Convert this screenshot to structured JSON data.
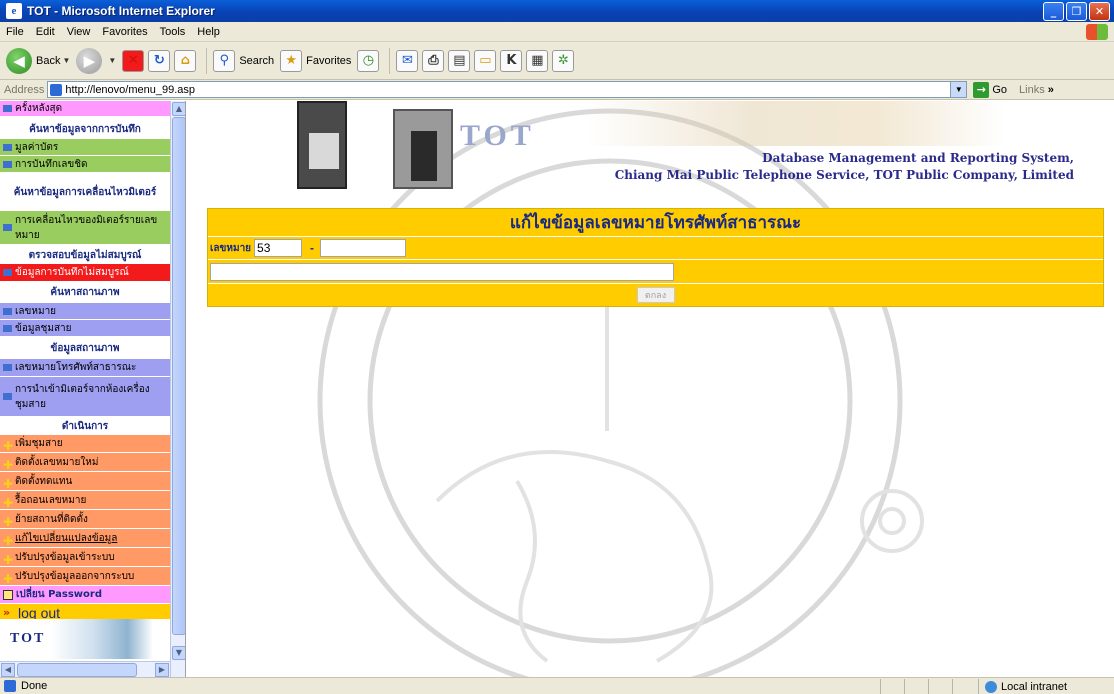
{
  "window": {
    "title": "TOT - Microsoft Internet Explorer"
  },
  "menu": [
    "File",
    "Edit",
    "View",
    "Favorites",
    "Tools",
    "Help"
  ],
  "toolbar": {
    "back": "Back",
    "search": "Search",
    "favorites": "Favorites"
  },
  "address": {
    "label": "Address",
    "url": "http://lenovo/menu_99.asp",
    "go": "Go",
    "links": "Links",
    "links_more": "»"
  },
  "sidebar": {
    "items": [
      {
        "label": "ครั้งหลังสุด",
        "kind": "item",
        "color": "pink"
      },
      {
        "label": "ค้นหาข้อมูลจากการบันทึก",
        "kind": "header"
      },
      {
        "label": "มูลค่าบัตร",
        "kind": "item",
        "color": "green"
      },
      {
        "label": "การบันทึกเลขชิด",
        "kind": "item",
        "color": "green"
      },
      {
        "label": "ค้นหาข้อมูลการเคลื่อนไหวมิเตอร์",
        "kind": "header"
      },
      {
        "label": "การเคลื่อนไหวของมิเตอร์รายเลขหมาย",
        "kind": "item",
        "color": "green"
      },
      {
        "label": "ตรวจสอบข้อมูลไม่สมบูรณ์",
        "kind": "header"
      },
      {
        "label": "ข้อมูลการบันทึกไม่สมบูรณ์",
        "kind": "item",
        "color": "red"
      },
      {
        "label": "ค้นหาสถานภาพ",
        "kind": "header"
      },
      {
        "label": "เลขหมาย",
        "kind": "item",
        "color": "violet"
      },
      {
        "label": "ข้อมูลชุมสาย",
        "kind": "item",
        "color": "violet"
      },
      {
        "label": "ข้อมูลสถานภาพ",
        "kind": "header"
      },
      {
        "label": "เลขหมายโทรศัพท์สาธารณะ",
        "kind": "item",
        "color": "violet"
      },
      {
        "label": "การนำเข้ามิเตอร์จากห้องเครื่องชุมสาย",
        "kind": "item",
        "color": "violet"
      },
      {
        "label": "ดำเนินการ",
        "kind": "header"
      },
      {
        "label": "เพิ่มชุมสาย",
        "kind": "item",
        "color": "orange"
      },
      {
        "label": "ติดตั้งเลขหมายใหม่",
        "kind": "item",
        "color": "orange"
      },
      {
        "label": "ติดตั้งทดแทน",
        "kind": "item",
        "color": "orange"
      },
      {
        "label": "รื้อถอนเลขหมาย",
        "kind": "item",
        "color": "orange"
      },
      {
        "label": "ย้ายสถานที่ติดตั้ง",
        "kind": "item",
        "color": "orange"
      },
      {
        "label": "แก้ไขเปลี่ยนแปลงข้อมูล",
        "kind": "item",
        "color": "orange"
      },
      {
        "label": "ปรับปรุงข้อมูลเข้าระบบ",
        "kind": "item",
        "color": "orange"
      },
      {
        "label": "ปรับปรุงข้อมูลออกจากระบบ",
        "kind": "item",
        "color": "orange"
      },
      {
        "label": "เปลี่ยน Password",
        "kind": "item",
        "color": "pink"
      },
      {
        "label": "log out",
        "kind": "item",
        "color": "yellow"
      }
    ],
    "logo_text": "TOT"
  },
  "banner": {
    "logo": "TOT",
    "line1": "Database Management and Reporting System,",
    "line2": "Chiang Mai Public Telephone Service, TOT Public Company, Limited"
  },
  "form": {
    "heading": "แก้ไขข้อมูลเลขหมายโทรศัพท์สาธารณะ",
    "number_label": "เลขหมาย",
    "number_prefix": "53",
    "dash": "-",
    "number_suffix": "",
    "detail": "",
    "ok_label": "ตกลง"
  },
  "status": {
    "text": "Done",
    "zone": "Local intranet"
  },
  "colors": {
    "yellow": "#ffcc00",
    "pink": "#ff99ff",
    "green": "#9acd60",
    "red": "#f21a1a",
    "violet": "#9f9ff2",
    "orange": "#ff9966"
  }
}
